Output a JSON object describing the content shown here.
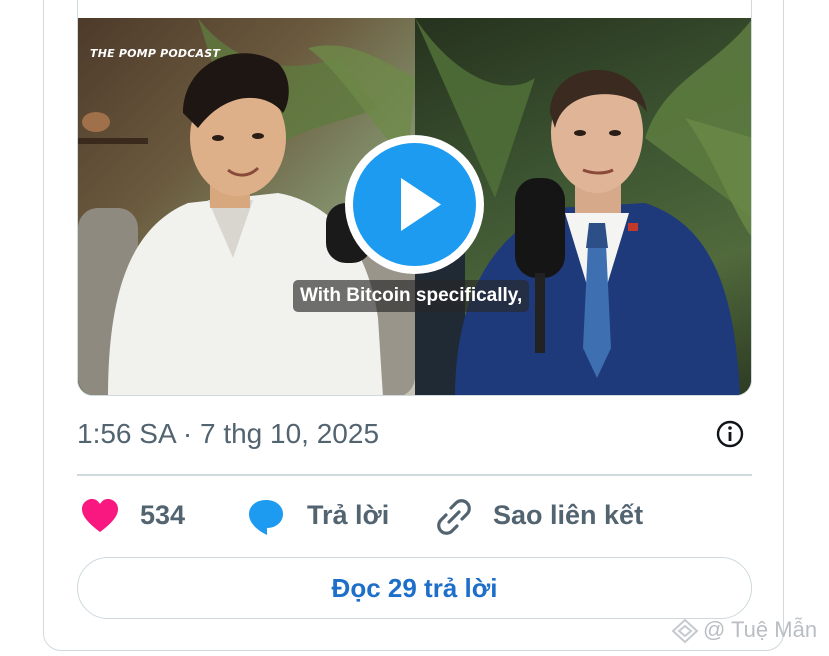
{
  "post": {
    "video": {
      "channel_logo": "THE POMP PODCAST",
      "caption": "With Bitcoin specifically,",
      "play_icon": "play-icon"
    },
    "timestamp": "1:56 SA · 7 thg 10, 2025",
    "info_icon": "info-icon",
    "actions": {
      "like_count": "534",
      "reply_label": "Trả lời",
      "copy_link_label": "Sao liên kết"
    },
    "read_replies_label": "Đọc 29 trả lời"
  },
  "watermark": "@ Tuệ Mẫn",
  "colors": {
    "like": "#f91880",
    "reply_bubble": "#1d9bf0",
    "link": "#1d6fc9",
    "muted": "#536471",
    "border": "#cfd9de"
  }
}
